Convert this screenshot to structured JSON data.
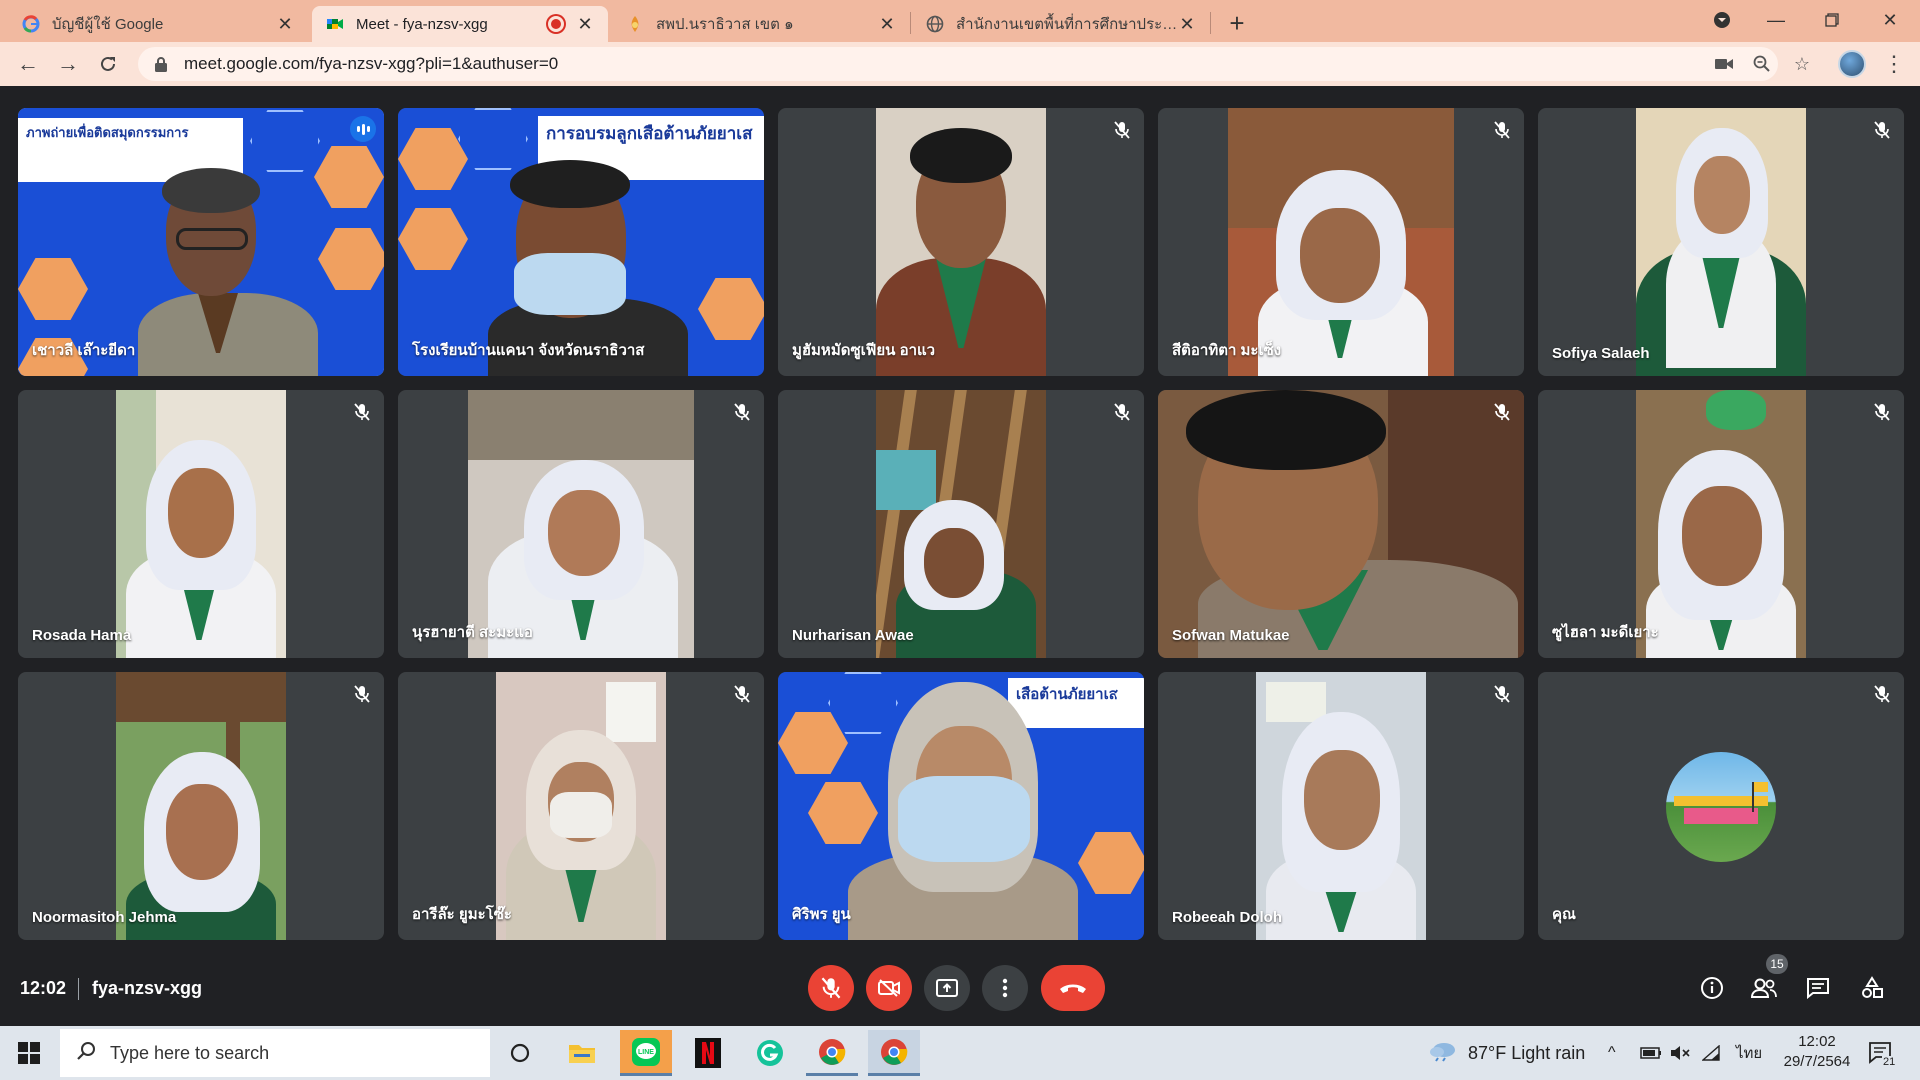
{
  "browser": {
    "tabs": [
      {
        "title": "บัญชีผู้ใช้ Google",
        "icon": "google-icon",
        "active": false
      },
      {
        "title": "Meet - fya-nzsv-xgg",
        "icon": "meet-icon",
        "active": true,
        "recording": true
      },
      {
        "title": "สพป.นราธิวาส เขต ๑",
        "icon": "site-icon",
        "active": false
      },
      {
        "title": "สำนักงานเขตพื้นที่การศึกษาประถมศึกษ",
        "icon": "globe-icon",
        "active": false
      }
    ],
    "url": "meet.google.com/fya-nzsv-xgg?pli=1&authuser=0"
  },
  "meet": {
    "tiles": [
      {
        "name": "เชาวลี เล๊าะยีดา",
        "speaking": true
      },
      {
        "name": "โรงเรียนบ้านแคนา จังหวัดนราธิวาส"
      },
      {
        "name": "มูฮัมหมัดซูเฟียน อาแว"
      },
      {
        "name": "สีติอาทิตา มะเซ็ง"
      },
      {
        "name": "Sofiya Salaeh"
      },
      {
        "name": "Rosada Hama"
      },
      {
        "name": "นุรฮายาตี สะมะแอ"
      },
      {
        "name": "Nurharisan Awae"
      },
      {
        "name": "Sofwan Matukae"
      },
      {
        "name": "ซูไฮลา มะดีเยาะ"
      },
      {
        "name": "Noormasitoh Jehma"
      },
      {
        "name": "อารีล๊ะ ยูมะโซ๊ะ"
      },
      {
        "name": "ศิริพร ยูน"
      },
      {
        "name": "Robeeah Doloh"
      },
      {
        "name": "คุณ"
      }
    ],
    "banner_text_1": "ภาพถ่ายเพื่อติดสมุดกรรมการ",
    "banner_text_2": "การอบรมลูกเสือต้านภัยยาเส",
    "banner_text_3": "เสือต้านภัยยาเส",
    "bottom": {
      "time": "12:02",
      "meeting_code": "fya-nzsv-xgg",
      "participants_count": "15"
    }
  },
  "taskbar": {
    "search_placeholder": "Type here to search",
    "weather": "87°F  Light rain",
    "language": "ไทย",
    "time": "12:02",
    "date": "29/7/2564",
    "notifications": "21"
  },
  "colors": {
    "tab_strip": "#f1b9a0",
    "toolbar": "#fbe3d8",
    "meet_bg": "#202124",
    "tile_bg": "#3c4043",
    "danger": "#ea4335",
    "speaking_border": "#8ab4f8"
  }
}
